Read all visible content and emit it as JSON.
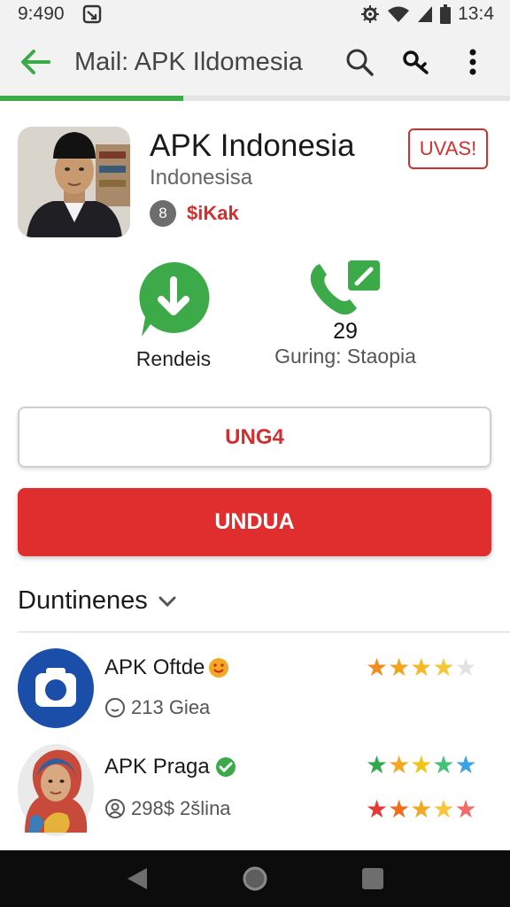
{
  "status_bar": {
    "time": "9:490",
    "battery_time": "13:4",
    "icons": [
      "notification-icon",
      "gear-status-icon",
      "wifi-icon",
      "signal-icon",
      "battery-icon"
    ]
  },
  "app_bar": {
    "title": "Mail: APK Ildomesia",
    "actions": [
      "search-icon",
      "key-icon",
      "more-vert-icon"
    ],
    "load_progress": 0.36,
    "colors": {
      "accent": "#3daa4a"
    }
  },
  "app_header": {
    "name": "APK Indonesia",
    "subtitle": "Indonesisa",
    "developer_badge": "8",
    "developer": "$iKak",
    "tag": "UVAS!"
  },
  "stats": [
    {
      "label": "Rendeis",
      "icon": "download-bubble-icon"
    },
    {
      "value": "29",
      "label": "Guring: Staopia",
      "icon": "phone-edit-icon"
    }
  ],
  "buttons": {
    "secondary": "UNG4",
    "primary": "UNDUA"
  },
  "section": {
    "title": "Duntinenes"
  },
  "list": [
    {
      "name": "APK Oftde",
      "meta": "213 Giea",
      "rating": 4,
      "icon": "camera-app-icon"
    },
    {
      "name": "APK Praga",
      "meta": "298$ 2šlina",
      "rating": 5,
      "icon": "avatar-hijab"
    }
  ],
  "colors": {
    "primary": "#e02d2d",
    "green": "#3daa4a",
    "dev_red": "#d32f2f"
  }
}
